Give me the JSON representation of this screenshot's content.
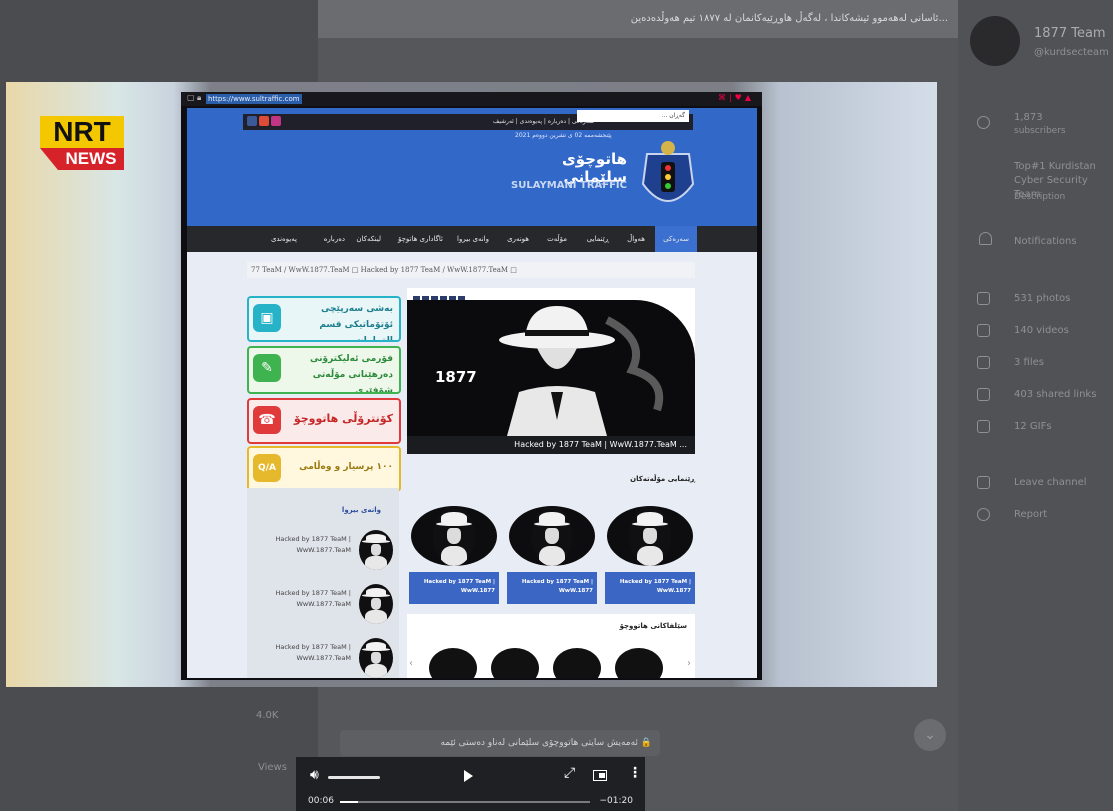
{
  "channel": {
    "name": "1877 Team",
    "handle": "@kurdsecteam",
    "subscribers": "1,873",
    "subscribers_label": "subscribers",
    "description": "Top#1 Kurdistan Cyber Security Team",
    "description_label": "Description",
    "notifications": "Notifications",
    "stats": [
      "531 photos",
      "140 videos",
      "3 files",
      "403 shared links",
      "12 GIFs"
    ],
    "leave": "Leave channel",
    "report": "Report"
  },
  "feed": {
    "top_message": "...ئاسانی لەهەموو ئیشەکاندا ، لەگەڵ هاوڕێیەکانمان لە ١٨٧٧ تیم هەوڵدەدەین",
    "reply_preview": "🔒 ئەمەیش سایتی هاتووچۆی سلێمانی لەناو دەستی ئێمە",
    "side_label": "4.0K",
    "side_label2": "Views"
  },
  "video": {
    "logo_top": "NRT",
    "logo_bottom": "NEWS",
    "browser_url": "https://www.sultraffic.com",
    "site": {
      "search_placeholder": "گەڕان ...",
      "top_links": "سەرەکی  |  دەربارە  |  پەیوەندی  |  ئەرشیف",
      "date": "پێنجشەممە 02 ی تشرین دووەم 2021",
      "title_ku": "هاتوچۆی سلێمانی",
      "title_en": "SULAYMANI TRAFFIC",
      "nav": [
        "سەرەکی",
        "هەواڵ",
        "ڕێنمایی",
        "مۆڵەت",
        "هونەری",
        "وانەی بیروا",
        "ئاگاداری هاتوچۆ",
        "لینکەکان",
        "دەربارە",
        "پەیوەندی"
      ],
      "ticker": "77 TeaM / WwW.1877.TeaM      □ Hacked by 1877 TeaM / WwW.1877.TeaM □",
      "banners": [
        {
          "text": "بەشی سەرپێچی ئۆتۆماتیکی قسم الغرامات",
          "icon": "📷"
        },
        {
          "text": "فۆرمی ئەلیکترۆنی دەرهێنانی مۆڵەتی شۆفێری",
          "icon": "✎"
        },
        {
          "text": "کۆنترۆڵی هاتووچۆ ١٨٨",
          "icon": "☎"
        },
        {
          "text": "١٠٠ پرسیار و وەڵامی تیۆری",
          "icon": "Q/A"
        }
      ],
      "sidebox_title": "وانەی بیروا",
      "side_items": [
        "Hacked by 1877 TeaM | WwW.1877.TeaM",
        "Hacked by 1877 TeaM | WwW.1877.TeaM",
        "Hacked by 1877 TeaM | WwW.1877.TeaM"
      ],
      "hero_number": "1877",
      "hero_caption": "Hacked by 1877 TeaM | WwW.1877.TeaM ...",
      "reports_heading": "ڕێنمایی مۆڵەتەکان",
      "cards": [
        "Hacked by 1877 TeaM | WwW.1877",
        "Hacked by 1877 TeaM | WwW.1877",
        "Hacked by 1877 TeaM | WwW.1877"
      ],
      "traffic_heading": "سێلفاکانی هاتووچۆ"
    }
  },
  "player": {
    "time_current": "00:06",
    "time_remaining": "−01:20",
    "progress": 0.07,
    "volume": 0.85
  },
  "colors": {
    "site_blue": "#3268c8",
    "nrt_yellow": "#f4c800",
    "nrt_red": "#d6232a"
  }
}
